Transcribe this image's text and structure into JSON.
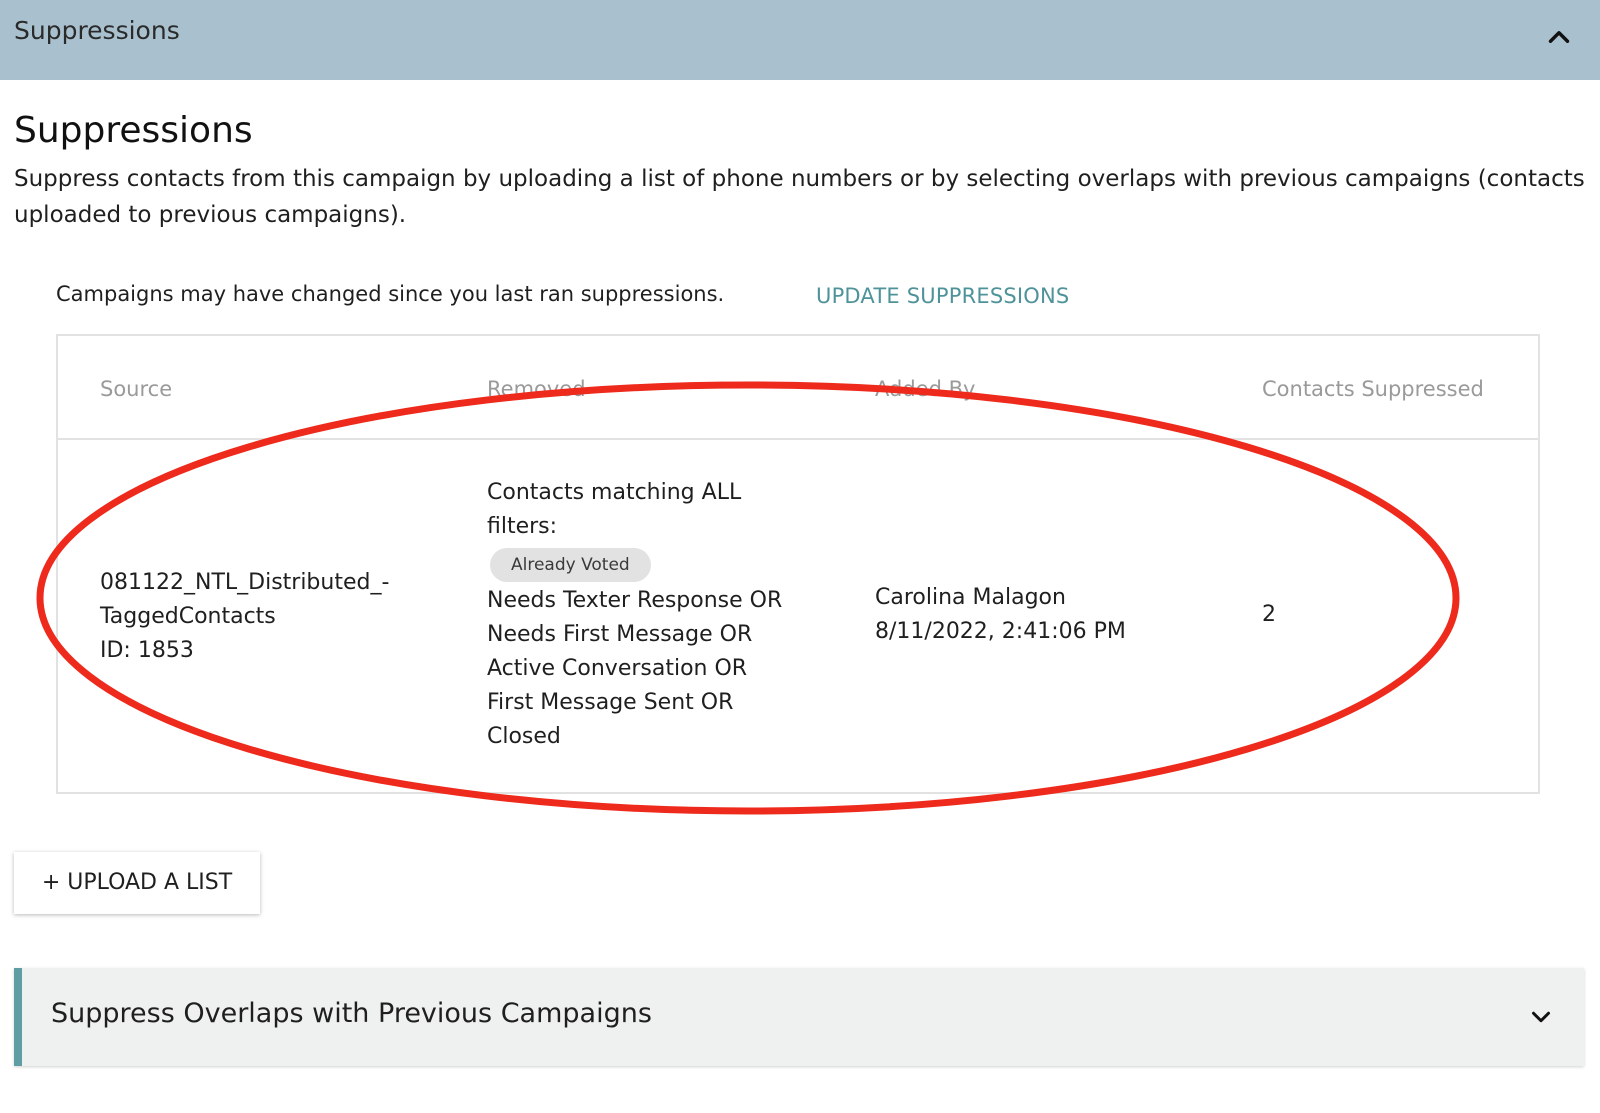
{
  "header": {
    "title": "Suppressions",
    "toggle_icon": "chevron-up-icon"
  },
  "section": {
    "title": "Suppressions",
    "description": "Suppress contacts from this campaign by uploading a list of phone numbers or by selecting overlaps with previous campaigns (contacts uploaded to previous campaigns)."
  },
  "notice": {
    "text": "Campaigns may have changed since you last ran suppressions.",
    "action_label": "UPDATE SUPPRESSIONS"
  },
  "table": {
    "columns": [
      "Source",
      "Removed",
      "Added By",
      "Contacts Suppressed"
    ],
    "rows": [
      {
        "source_line1": "081122_NTL_Distributed_-",
        "source_line2": "TaggedContacts",
        "source_id": "ID: 1853",
        "removed_intro_1": "Contacts matching ALL",
        "removed_intro_2": "filters:",
        "removed_tag": "Already Voted",
        "removed_statuses": [
          "Needs Texter Response OR",
          "Needs First Message OR",
          "Active Conversation OR",
          "First Message Sent OR",
          "Closed"
        ],
        "added_by_name": "Carolina Malagon",
        "added_by_date": "8/11/2022, 2:41:06 PM",
        "contacts_suppressed": "2"
      }
    ]
  },
  "upload_button": {
    "label": "+ UPLOAD A LIST"
  },
  "overlap_panel": {
    "title": "Suppress Overlaps with Previous Campaigns",
    "toggle_icon": "chevron-down-icon"
  },
  "colors": {
    "header_bg": "#a9c1cf",
    "link": "#4e9399",
    "accent_bar": "#5e9ea3",
    "annotation": "#ee2a1c"
  }
}
